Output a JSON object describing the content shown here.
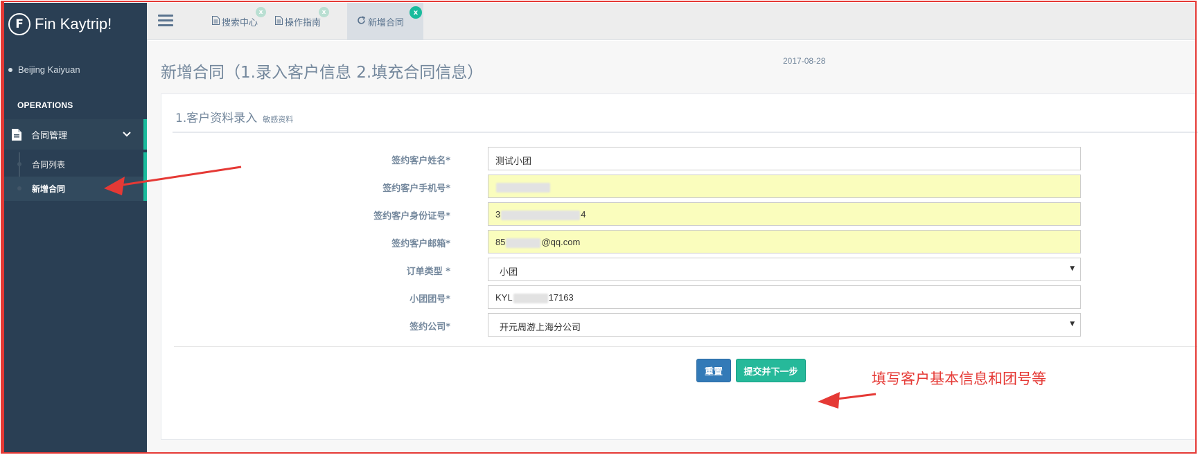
{
  "sidebar": {
    "brand_logo": "F",
    "brand_name": "Fin Kaytrip!",
    "location": "Beijing Kaiyuan",
    "section_title": "OPERATIONS",
    "menu_parent": "合同管理",
    "items": [
      {
        "label": "合同列表",
        "active": false
      },
      {
        "label": "新增合同",
        "active": true
      }
    ]
  },
  "topnav": {
    "tabs": [
      {
        "label": "搜索中心",
        "icon": "document-icon",
        "close": "x",
        "active": false
      },
      {
        "label": "操作指南",
        "icon": "document-icon",
        "close": "x",
        "active": false
      },
      {
        "label": "新增合同",
        "icon": "refresh-icon",
        "close": "x",
        "active": true
      }
    ]
  },
  "main": {
    "page_title": "新增合同（1.录入客户信息 2.填充合同信息）",
    "date": "2017-08-28",
    "panel_title": "1.客户资料录入",
    "panel_subtitle": "敏感资料",
    "form": {
      "fields": [
        {
          "label": "签约客户姓名*",
          "value": "测试小团",
          "type": "text",
          "autofill": false
        },
        {
          "label": "签约客户手机号*",
          "value": "",
          "type": "text",
          "autofill": true,
          "redacted": true
        },
        {
          "label": "签约客户身份证号*",
          "value_prefix": "3",
          "value_suffix": "4",
          "type": "text",
          "autofill": true
        },
        {
          "label": "签约客户邮箱*",
          "value_prefix": "85",
          "value_suffix": "@qq.com",
          "type": "text",
          "autofill": true
        },
        {
          "label": "订单类型 *",
          "value": "小团",
          "type": "select"
        },
        {
          "label": "小团团号*",
          "value_prefix": "KYL",
          "value_suffix": "17163",
          "type": "text",
          "autofill": false
        },
        {
          "label": "签约公司*",
          "value": "开元周游上海分公司",
          "type": "select"
        }
      ],
      "reset_label": "重置",
      "submit_label": "提交并下一步"
    }
  },
  "annotation": {
    "text": "填写客户基本信息和团号等",
    "color": "#e53935"
  },
  "colors": {
    "sidebar_bg": "#2a3f54",
    "accent_green": "#1abb9c",
    "primary_blue": "#337ab7",
    "autofill_yellow": "#fafdbd"
  }
}
